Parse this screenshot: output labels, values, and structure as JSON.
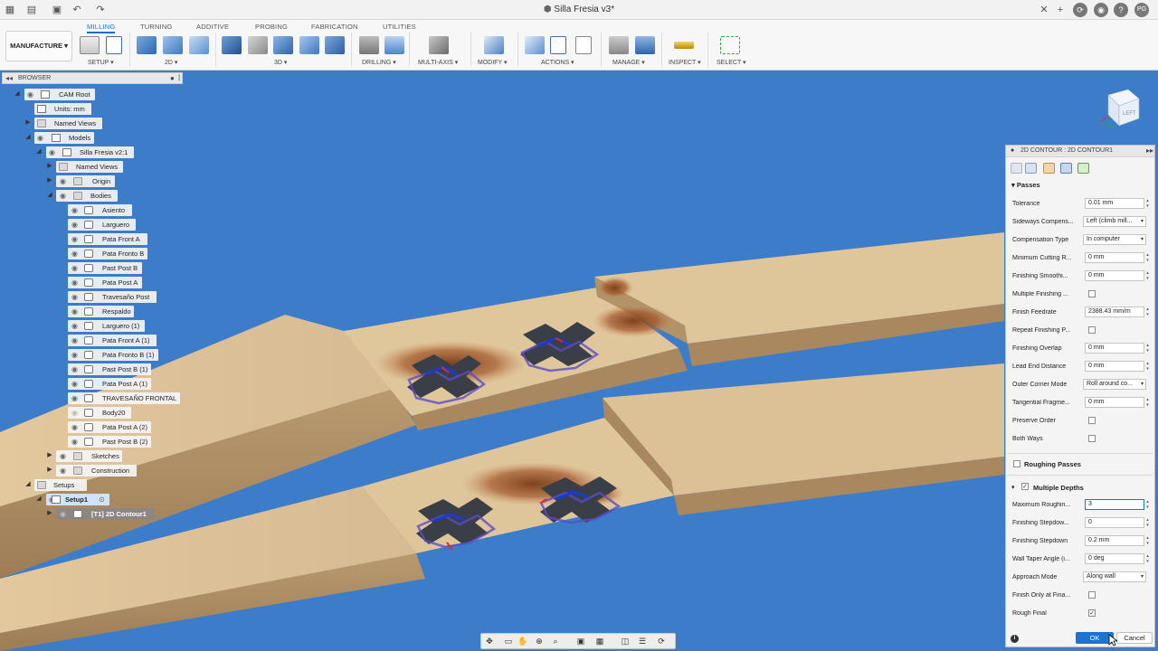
{
  "app": {
    "document_title": "Silla Fresia v3*",
    "user_initials": "PG"
  },
  "ribbon": {
    "workspace": "MANUFACTURE ▾",
    "tabs": [
      {
        "label": "MILLING",
        "active": true
      },
      {
        "label": "TURNING"
      },
      {
        "label": "ADDITIVE"
      },
      {
        "label": "PROBING"
      },
      {
        "label": "FABRICATION"
      },
      {
        "label": "UTILITIES"
      }
    ],
    "groups": {
      "setup": "SETUP ▾",
      "g2d": "2D ▾",
      "g3d": "3D ▾",
      "drilling": "DRILLING ▾",
      "multiaxis": "MULTI-AXIS ▾",
      "modify": "MODIFY ▾",
      "actions": "ACTIONS ▾",
      "manage": "MANAGE ▾",
      "inspect": "INSPECT ▾",
      "select": "SELECT ▾"
    }
  },
  "browser": {
    "title": "BROWSER",
    "nodes": {
      "cam_root": "CAM Root",
      "units": "Units: mm",
      "named_views": "Named Views",
      "models": "Models",
      "silla": "Silla Fresia v2:1",
      "named_views_2": "Named Views",
      "origin": "Origin",
      "bodies": "Bodies",
      "b1": "Asiento",
      "b2": "Larguero",
      "b3": "Pata Front A",
      "b4": "Pata Fronto B",
      "b5": "Past Post B",
      "b6": "Pata Post A",
      "b7": "Travesaño Post",
      "b8": "Respaldo",
      "b9": "Larguero (1)",
      "b10": "Pata Front A (1)",
      "b11": "Pata Fronto B (1)",
      "b12": "Past Post B (1)",
      "b13": "Pata Post A (1)",
      "b14": "TRAVESAÑO FRONTAL",
      "b15": "Body20",
      "b16": "Pata Post A (2)",
      "b17": "Past Post B (2)",
      "sketches": "Sketches",
      "construction": "Construction",
      "setups": "Setups",
      "setup1": "Setup1",
      "op1": "[T1] 2D Contour1"
    }
  },
  "viewcube": {
    "face_label": "LEFT"
  },
  "dialog": {
    "title": "2D CONTOUR : 2D CONTOUR1",
    "passes_section": "Passes",
    "rows": {
      "tolerance": {
        "label": "Tolerance",
        "value": "0.01 mm"
      },
      "sideways": {
        "label": "Sideways Compens...",
        "value": "Left (climb mill..."
      },
      "comp_type": {
        "label": "Compensation Type",
        "value": "In computer"
      },
      "min_cut": {
        "label": "Minimum Cutting R...",
        "value": "0 mm"
      },
      "fin_smooth": {
        "label": "Finishing Smoothi...",
        "value": "0 mm"
      },
      "multi_fin": {
        "label": "Multiple Finishing ...",
        "checked": false
      },
      "fin_feed": {
        "label": "Finish Feedrate",
        "value": "2388.43 mm/m"
      },
      "repeat_fin": {
        "label": "Repeat Finishing P...",
        "checked": false
      },
      "fin_overlap": {
        "label": "Finishing Overlap",
        "value": "0 mm"
      },
      "lead_end": {
        "label": "Lead End Distance",
        "value": "0 mm"
      },
      "outer_corner": {
        "label": "Outer Corner Mode",
        "value": "Roll around co..."
      },
      "tangential": {
        "label": "Tangential Fragme...",
        "value": "0 mm"
      },
      "preserve": {
        "label": "Preserve Order",
        "checked": false
      },
      "both_ways": {
        "label": "Both Ways",
        "checked": false
      },
      "max_rough": {
        "label": "Maximum Roughin...",
        "value": "3"
      },
      "fin_stepdowns": {
        "label": "Finishing Stepdow...",
        "value": "0"
      },
      "fin_stepdown": {
        "label": "Finishing Stepdown",
        "value": "0.2 mm"
      },
      "wall_taper": {
        "label": "Wall Taper Angle (i...",
        "value": "0 deg"
      },
      "approach": {
        "label": "Approach Mode",
        "value": "Along wall"
      },
      "finish_only": {
        "label": "Finish Only at Fina...",
        "checked": false
      },
      "rough_final": {
        "label": "Rough Final",
        "checked": true
      }
    },
    "roughing_section": "Roughing Passes",
    "roughing_checked": false,
    "depths_section": "Multiple Depths",
    "depths_checked": true,
    "ok": "OK",
    "cancel": "Cancel"
  },
  "colors": {
    "accent": "#1e73cf",
    "viewport_bg": "#3d7cc9",
    "wood": "#d8b98c"
  }
}
